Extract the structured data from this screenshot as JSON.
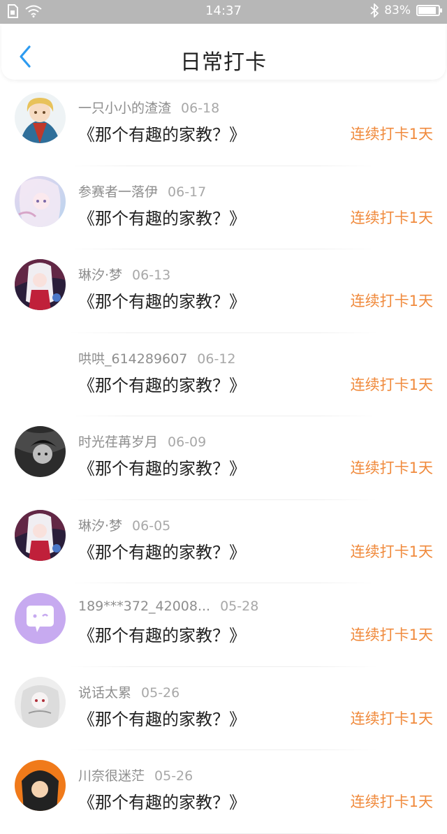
{
  "status_bar": {
    "time": "14:37",
    "battery_text": "83%",
    "battery_level": 0.83
  },
  "header": {
    "title": "日常打卡",
    "back_icon": "chevron-left-icon"
  },
  "colors": {
    "accent": "#2d9bf0",
    "streak": "#f08a3c"
  },
  "entries": [
    {
      "username": "一只小小的渣渣",
      "date": "06-18",
      "book": "《那个有趣的家教？》",
      "streak": "连续打卡1天",
      "avatar": "anime-avatar-blond"
    },
    {
      "username": "参赛者一落伊",
      "date": "06-17",
      "book": "《那个有趣的家教？》",
      "streak": "连续打卡1天",
      "avatar": "anime-avatar-pastel"
    },
    {
      "username": "琳汐·梦",
      "date": "06-13",
      "book": "《那个有趣的家教？》",
      "streak": "连续打卡1天",
      "avatar": "anime-avatar-red-white"
    },
    {
      "username": "哄哄_614289607",
      "date": "06-12",
      "book": "《那个有趣的家教？》",
      "streak": "连续打卡1天",
      "avatar": ""
    },
    {
      "username": "时光荏苒岁月",
      "date": "06-09",
      "book": "《那个有趣的家教？》",
      "streak": "连续打卡1天",
      "avatar": "anime-avatar-monochrome"
    },
    {
      "username": "琳汐·梦",
      "date": "06-05",
      "book": "《那个有趣的家教？》",
      "streak": "连续打卡1天",
      "avatar": "anime-avatar-red-white"
    },
    {
      "username": "189***372_42008...",
      "date": "05-28",
      "book": "《那个有趣的家教？》",
      "streak": "连续打卡1天",
      "avatar": "default-chat-avatar"
    },
    {
      "username": "说话太累",
      "date": "05-26",
      "book": "《那个有趣的家教？》",
      "streak": "连续打卡1天",
      "avatar": "anime-avatar-sketch"
    },
    {
      "username": "川奈很迷茫",
      "date": "05-26",
      "book": "《那个有趣的家教？》",
      "streak": "连续打卡1天",
      "avatar": "anime-avatar-orange"
    }
  ]
}
